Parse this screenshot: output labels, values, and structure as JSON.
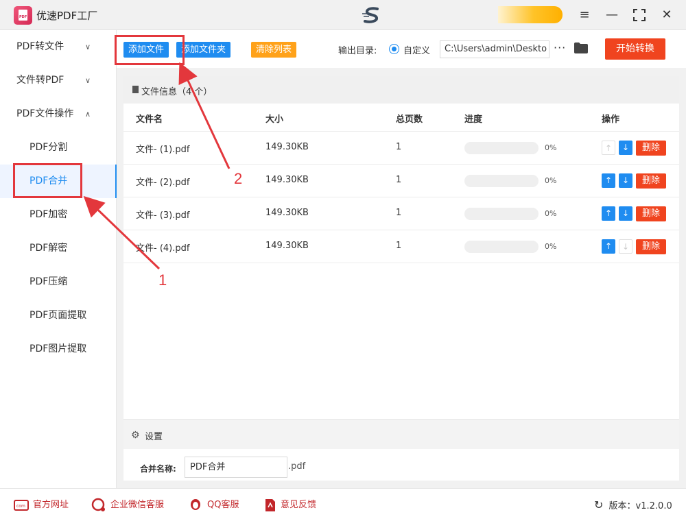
{
  "app": {
    "title": "优速PDF工厂"
  },
  "window_controls": [
    "menu-icon",
    "minimize-icon",
    "maximize-icon",
    "close-icon"
  ],
  "sidebar": {
    "groups": [
      {
        "label": "PDF转文件",
        "expanded": false
      },
      {
        "label": "文件转PDF",
        "expanded": false
      },
      {
        "label": "PDF文件操作",
        "expanded": true
      }
    ],
    "items": [
      "PDF分割",
      "PDF合并",
      "PDF加密",
      "PDF解密",
      "PDF压缩",
      "PDF页面提取",
      "PDF图片提取"
    ],
    "active_item": "PDF合并"
  },
  "toolbar": {
    "add_file": "添加文件",
    "add_folder": "添加文件夹",
    "clear_list": "清除列表",
    "output_label": "输出目录:",
    "radio_label": "自定义",
    "output_path": "C:\\Users\\admin\\Deskto",
    "more": "···",
    "start": "开始转换"
  },
  "file_panel": {
    "header": "文件信息（4 个）",
    "columns": [
      "文件名",
      "大小",
      "总页数",
      "进度",
      "操作"
    ],
    "rows": [
      {
        "name": "文件- (1).pdf",
        "size": "149.30KB",
        "pages": "1",
        "progress": "0%",
        "up_enabled": false,
        "down_enabled": true
      },
      {
        "name": "文件- (2).pdf",
        "size": "149.30KB",
        "pages": "1",
        "progress": "0%",
        "up_enabled": true,
        "down_enabled": true
      },
      {
        "name": "文件- (3).pdf",
        "size": "149.30KB",
        "pages": "1",
        "progress": "0%",
        "up_enabled": true,
        "down_enabled": true
      },
      {
        "name": "文件- (4).pdf",
        "size": "149.30KB",
        "pages": "1",
        "progress": "0%",
        "up_enabled": true,
        "down_enabled": false
      }
    ],
    "delete_label": "删除"
  },
  "settings": {
    "title": "设置",
    "merge_label": "合并名称:",
    "merge_value": "PDF合并",
    "merge_ext": ".pdf"
  },
  "footer": {
    "links": [
      "官方网址",
      "企业微信客服",
      "QQ客服",
      "意见反馈"
    ],
    "version": "版本：v1.2.0.0"
  },
  "annotations": {
    "step1": "1",
    "step2": "2"
  },
  "colors": {
    "accent": "#1f8cf0",
    "danger": "#f0441f",
    "warning": "#ffa21a",
    "annotation": "#e3373c"
  }
}
